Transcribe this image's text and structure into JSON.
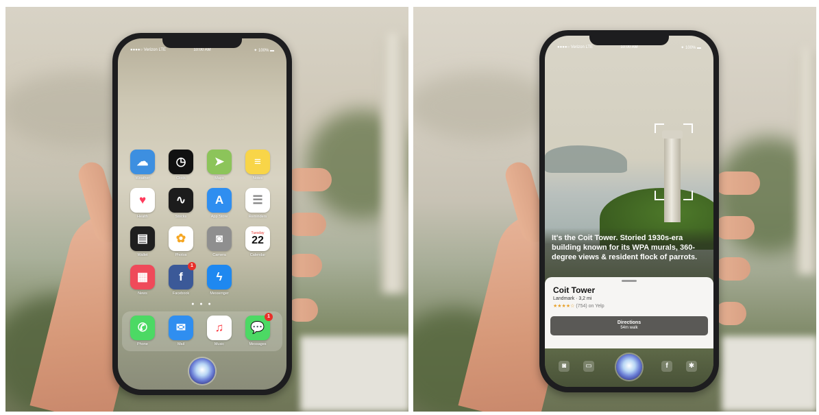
{
  "left_phone": {
    "status": {
      "carrier": "●●●●○ Verizon  LTE",
      "time": "10:00 AM",
      "battery": "✦ 100% ▬"
    },
    "apps": [
      {
        "label": "Weather",
        "icon": "weather-icon",
        "color": "#3d8fe0"
      },
      {
        "label": "Clock",
        "icon": "clock-icon",
        "color": "#111111"
      },
      {
        "label": "Maps",
        "icon": "maps-icon",
        "color": "#8cc45a"
      },
      {
        "label": "Notes",
        "icon": "notes-icon",
        "color": "#f8d548"
      },
      {
        "label": "Health",
        "icon": "heart-icon",
        "color": "#ffffff"
      },
      {
        "label": "Stocks",
        "icon": "stocks-icon",
        "color": "#1c1c1c"
      },
      {
        "label": "App Store",
        "icon": "app-store-icon",
        "color": "#2f8ef0"
      },
      {
        "label": "Reminders",
        "icon": "reminders-icon",
        "color": "#ffffff"
      },
      {
        "label": "Wallet",
        "icon": "wallet-icon",
        "color": "#1f1f1f"
      },
      {
        "label": "Photos",
        "icon": "photos-icon",
        "color": "#ffffff"
      },
      {
        "label": "Camera",
        "icon": "camera-icon",
        "color": "#8f8f8f"
      },
      {
        "label": "Calendar",
        "icon": "calendar-icon",
        "color": "#ffffff",
        "day": "Tuesday",
        "date": "22"
      },
      {
        "label": "News",
        "icon": "news-icon",
        "color": "#ef4a5a"
      },
      {
        "label": "Facebook",
        "icon": "facebook-icon",
        "color": "#3b5998",
        "badge": "1"
      },
      {
        "label": "Messenger",
        "icon": "messenger-icon",
        "color": "#1e88f0"
      }
    ],
    "dock": [
      {
        "label": "Phone",
        "icon": "phone-icon",
        "color": "#4cd964"
      },
      {
        "label": "Mail",
        "icon": "mail-icon",
        "color": "#2f8ef0"
      },
      {
        "label": "Music",
        "icon": "music-icon",
        "color": "#ffffff"
      },
      {
        "label": "Messages",
        "icon": "messages-icon",
        "color": "#4cd964",
        "badge": "1"
      }
    ]
  },
  "right_phone": {
    "status": {
      "carrier": "●●●●○ Verizon  LTE",
      "time": "10:00 AM",
      "battery": "✦ 100% ▬"
    },
    "info_text": "It's the Coit Tower. Storied 1930s-era building known for its WPA murals, 360-degree views & resident flock of parrots.",
    "card": {
      "title": "Coit Tower",
      "subtitle": "Landmark · 3,2 mi",
      "stars": "★★★★☆",
      "reviews": "(754) on Yelp",
      "directions_label": "Directions",
      "directions_sub": "54m walk"
    },
    "dock_icons": [
      "camera-icon",
      "wallet-icon",
      "facebook-icon",
      "yelp-icon"
    ]
  },
  "colors": {
    "siri_orb": "#6b7fd6",
    "card_bg": "#f6f5f3",
    "button_bg": "#5a5956"
  }
}
